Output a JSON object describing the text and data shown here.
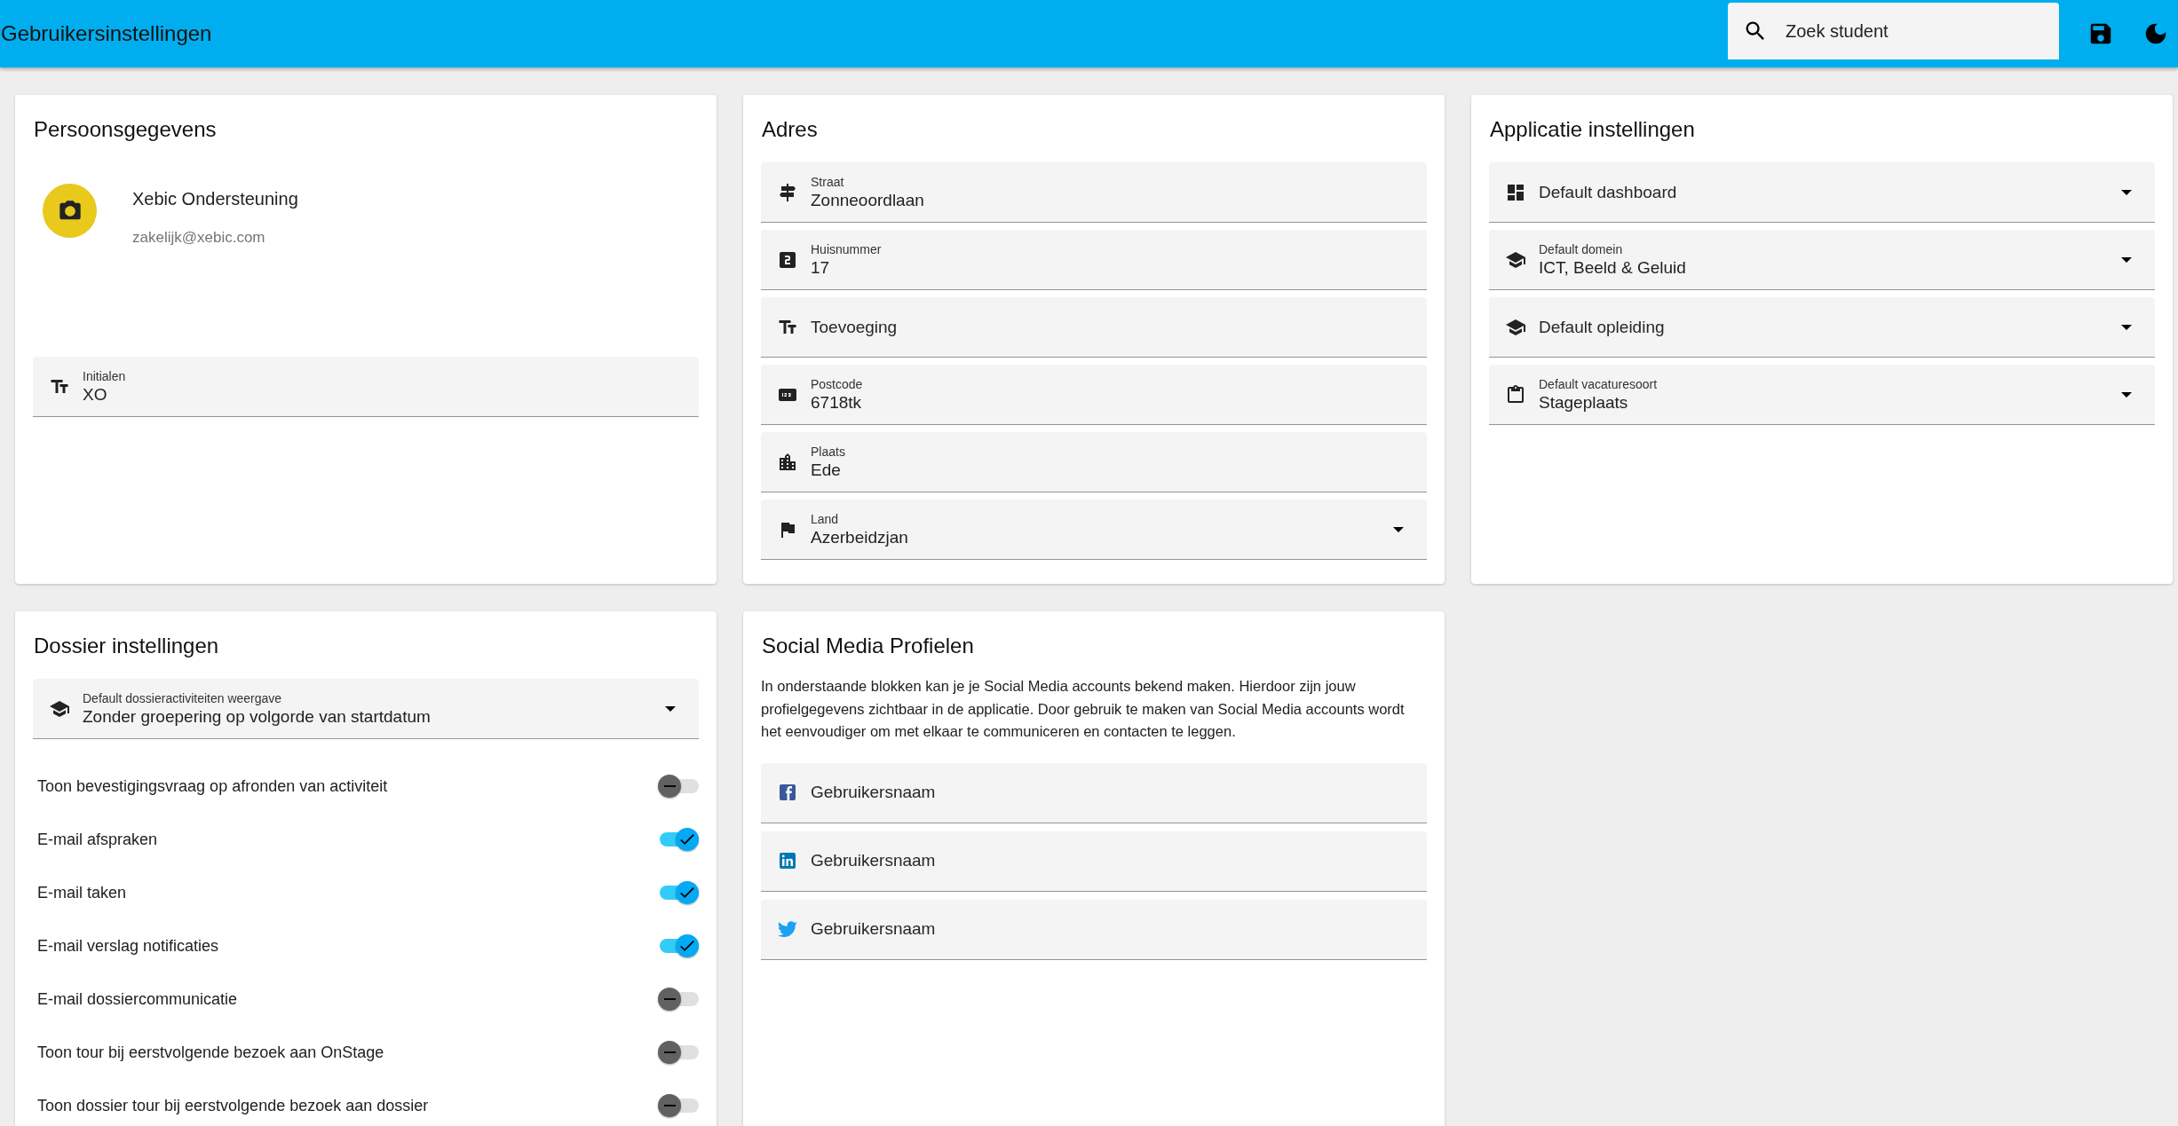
{
  "app_bar": {
    "title": "Gebruikersinstellingen",
    "search": {
      "placeholder": "Zoek student"
    }
  },
  "persoonsgegevens": {
    "title": "Persoonsgegevens",
    "name": "Xebic Ondersteuning",
    "email": "zakelijk@xebic.com",
    "fields": [
      {
        "kind": "text",
        "label": "Initialen",
        "value": "XO"
      }
    ]
  },
  "adres": {
    "title": "Adres",
    "fields": [
      {
        "kind": "text",
        "label": "Straat",
        "value": "Zonneoordlaan"
      },
      {
        "kind": "text",
        "label": "Huisnummer",
        "value": "17"
      },
      {
        "kind": "text",
        "placeholder": "Toevoeging"
      },
      {
        "kind": "text",
        "label": "Postcode",
        "value": "6718tk"
      },
      {
        "kind": "text",
        "label": "Plaats",
        "value": "Ede"
      },
      {
        "kind": "select",
        "label": "Land",
        "value": "Azerbeidzjan"
      }
    ]
  },
  "applicatie": {
    "title": "Applicatie instellingen",
    "fields": [
      {
        "kind": "select",
        "placeholder": "Default dashboard"
      },
      {
        "kind": "select",
        "label": "Default domein",
        "value": "ICT, Beeld & Geluid"
      },
      {
        "kind": "select",
        "placeholder": "Default opleiding"
      },
      {
        "kind": "select",
        "label": "Default vacaturesoort",
        "value": "Stageplaats"
      }
    ]
  },
  "dossier": {
    "title": "Dossier instellingen",
    "fields": [
      {
        "kind": "select",
        "label": "Default dossieractiviteiten weergave",
        "value": "Zonder groepering op volgorde van startdatum"
      }
    ],
    "toggles": [
      {
        "label": "Toon bevestigingsvraag op afronden van activiteit",
        "on": false
      },
      {
        "label": "E-mail afspraken",
        "on": true
      },
      {
        "label": "E-mail taken",
        "on": true
      },
      {
        "label": "E-mail verslag notificaties",
        "on": true
      },
      {
        "label": "E-mail dossiercommunicatie",
        "on": false
      },
      {
        "label": "Toon tour bij eerstvolgende bezoek aan OnStage",
        "on": false
      },
      {
        "label": "Toon dossier tour bij eerstvolgende bezoek aan dossier",
        "on": false
      }
    ]
  },
  "social": {
    "title": "Social Media Profielen",
    "intro": "In onderstaande blokken kan je je Social Media accounts bekend maken. Hierdoor zijn jouw profielgegevens zichtbaar in de applicatie. Door gebruik te maken van Social Media accounts wordt het eenvoudiger om met elkaar te communiceren en contacten te leggen.",
    "fields": [
      {
        "kind": "text",
        "placeholder": "Gebruikersnaam"
      },
      {
        "kind": "text",
        "placeholder": "Gebruikersnaam"
      },
      {
        "kind": "text",
        "placeholder": "Gebruikersnaam"
      }
    ]
  }
}
